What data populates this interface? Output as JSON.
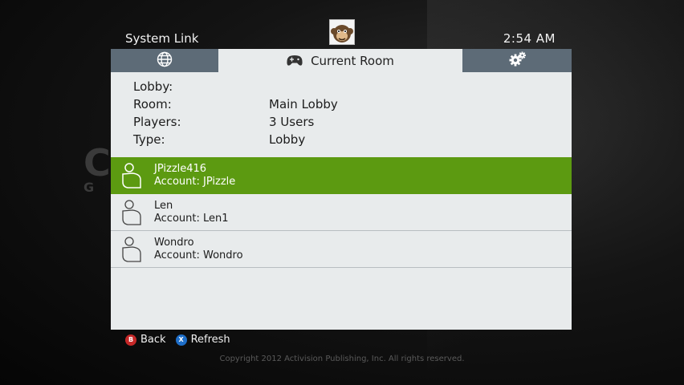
{
  "header": {
    "title": "System Link",
    "clock": "2:54  AM"
  },
  "background": {
    "logo_text": "CA",
    "logo_sub": "G"
  },
  "tabs": [
    {
      "name": "globe",
      "icon": "globe-icon"
    },
    {
      "name": "current-room",
      "label": "Current Room",
      "icon": "controller-icon"
    },
    {
      "name": "settings",
      "icon": "gear-icon"
    }
  ],
  "room": {
    "lobby_label": "Lobby:",
    "lobby_value": "",
    "room_label": "Room:",
    "room_value": "Main Lobby",
    "players_label": "Players:",
    "players_value": "3 Users",
    "type_label": "Type:",
    "type_value": "Lobby"
  },
  "players": [
    {
      "name": "JPizzle416",
      "account": "Account:  JPizzle",
      "selected": true
    },
    {
      "name": "Len",
      "account": "Account:  Len1",
      "selected": false
    },
    {
      "name": "Wondro",
      "account": "Account:  Wondro",
      "selected": false
    }
  ],
  "footer": {
    "back_glyph": "B",
    "back_label": "Back",
    "refresh_glyph": "X",
    "refresh_label": "Refresh"
  },
  "copyright": "Copyright 2012 Activision Publishing, Inc. All rights reserved.",
  "colors": {
    "selected": "#5c9a11",
    "tabbar": "#5d6b77",
    "panel": "#e8ebec"
  }
}
